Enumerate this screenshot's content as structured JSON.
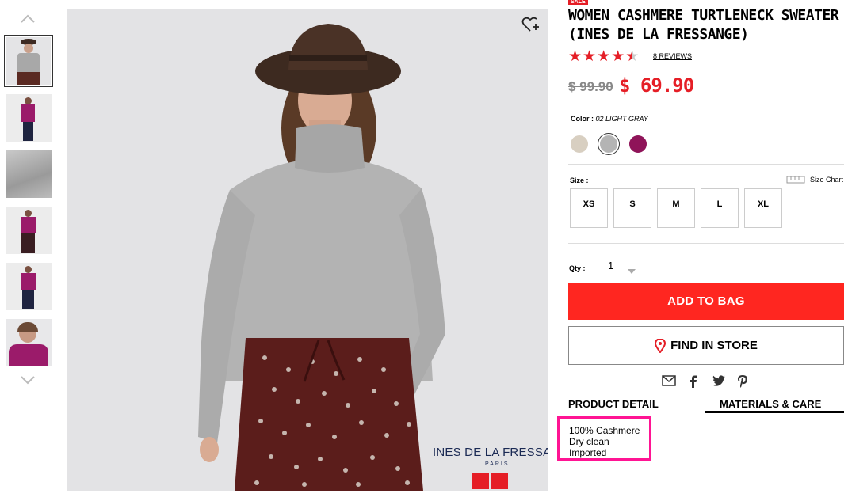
{
  "thumbnails": {
    "count": 6
  },
  "product": {
    "badge": "SALE",
    "title": "WOMEN CASHMERE TURTLENECK SWEATER (INES DE LA FRESSANGE)",
    "rating": 4.5,
    "reviews_label": "8 REVIEWS",
    "price_original": "$ 99.90",
    "price_sale": "$ 69.90"
  },
  "image": {
    "brand_line": "INES DE LA FRESSANGE",
    "brand_sub": "PARIS"
  },
  "color": {
    "label": "Color :",
    "selected": "02 LIGHT GRAY",
    "swatches": [
      "#d8cfc1",
      "#b4b4b4",
      "#8f1459"
    ]
  },
  "size": {
    "label": "Size :",
    "chart_label": "Size Chart",
    "options": [
      "XS",
      "S",
      "M",
      "L",
      "XL"
    ]
  },
  "qty": {
    "label": "Qty :",
    "value": "1"
  },
  "buttons": {
    "add_to_bag": "ADD TO BAG",
    "find_in_store": "FIND IN STORE"
  },
  "tabs": {
    "product_detail": "PRODUCT DETAIL",
    "materials_care": "MATERIALS & CARE"
  },
  "materials": [
    "100% Cashmere",
    "Dry clean",
    "Imported"
  ],
  "colors": {
    "accent": "#ff2620",
    "highlight": "#ff1493"
  }
}
